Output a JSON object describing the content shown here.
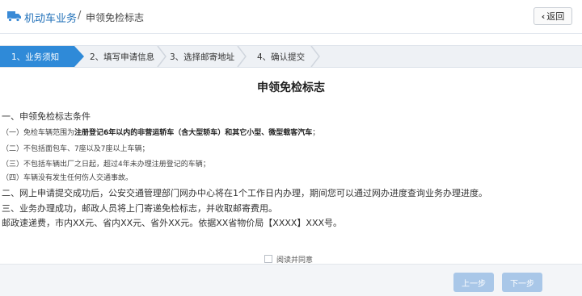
{
  "header": {
    "module": "机动车业务",
    "separator": "/",
    "page": "申领免检标志",
    "back_label": "返回",
    "back_icon": "chevron-left-icon",
    "brand_icon": "truck-icon"
  },
  "steps": [
    {
      "label": "1、业务须知",
      "active": true
    },
    {
      "label": "2、填写申请信息",
      "active": false
    },
    {
      "label": "3、选择邮寄地址",
      "active": false
    },
    {
      "label": "4、确认提交",
      "active": false
    }
  ],
  "content": {
    "title": "申领免检标志",
    "section1_heading": "一、申领免检标志条件",
    "cond1_prefix": "（一）免检车辆范围为",
    "cond1_bold": "注册登记6年以内的非营运轿车（含大型轿车）和其它小型、微型载客汽车",
    "cond1_suffix": "；",
    "cond2": "（二）不包括面包车、7座以及7座以上车辆；",
    "cond3": "（三）不包括车辆出厂之日起，超过4年未办理注册登记的车辆；",
    "cond4": "（四）车辆没有发生任何伤人交通事故。",
    "section2": "二、网上申请提交成功后，公安交通管理部门网办中心将在1个工作日内办理，期间您可以通过网办进度查询业务办理进度。",
    "section3": "三、业务办理成功，邮政人员将上门寄递免检标志，并收取邮寄费用。",
    "fee": "邮政速递费，市内XX元、省内XX元、省外XX元。依据XX省物价局【XXXX】XXX号。"
  },
  "footer": {
    "agree_label": "阅读并同意",
    "agree_checked": false,
    "prev_label": "上一步",
    "next_label": "下一步"
  },
  "colors": {
    "accent": "#2f8ad8",
    "link": "#1f6fb8",
    "button_disabled": "#a9c7e8"
  }
}
